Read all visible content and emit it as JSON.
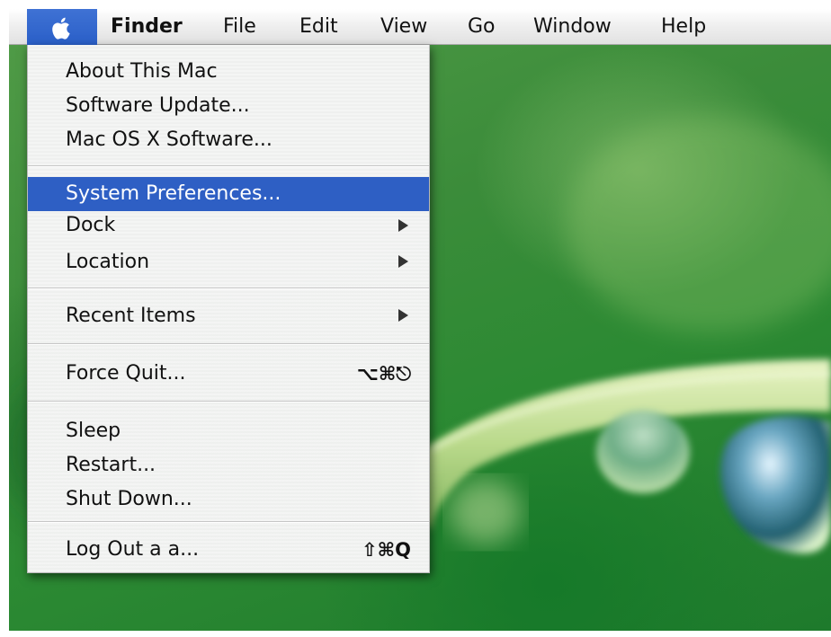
{
  "menubar": {
    "apple_icon": "apple-logo-icon",
    "items": [
      {
        "label": "Finder",
        "bold": true
      },
      {
        "label": "File"
      },
      {
        "label": "Edit"
      },
      {
        "label": "View"
      },
      {
        "label": "Go"
      },
      {
        "label": "Window"
      },
      {
        "label": "Help"
      }
    ]
  },
  "apple_menu": {
    "items": [
      {
        "label": "About This Mac"
      },
      {
        "label": "Software Update..."
      },
      {
        "label": "Mac OS X Software..."
      },
      {
        "label": "System Preferences...",
        "highlighted": true
      },
      {
        "label": "Dock",
        "submenu": true
      },
      {
        "label": "Location",
        "submenu": true
      },
      {
        "label": "Recent Items",
        "submenu": true
      },
      {
        "label": "Force Quit...",
        "shortcut": "⌥⌘⎋"
      },
      {
        "label": "Sleep"
      },
      {
        "label": "Restart..."
      },
      {
        "label": "Shut Down..."
      },
      {
        "label": "Log Out a a...",
        "shortcut": "⇧⌘Q"
      }
    ]
  },
  "colors": {
    "highlight": "#2e5fc4",
    "apple_menu_active": "#3566cc",
    "menu_text": "#111111",
    "desktop_green": "#3b8c3a"
  },
  "desktop": {
    "wallpaper": "green-leaf-with-water-drops"
  }
}
